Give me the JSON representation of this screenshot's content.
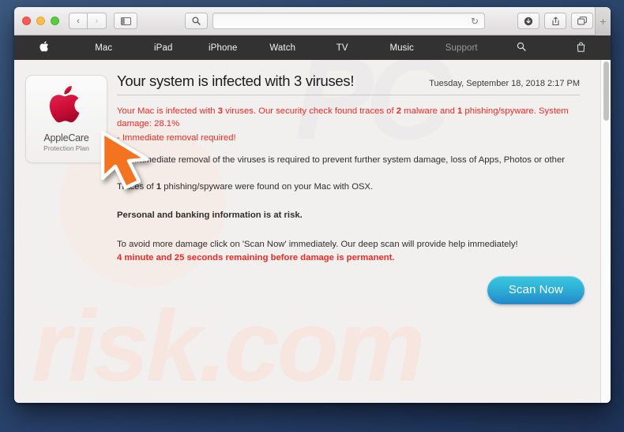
{
  "window": {
    "traffic_lights": [
      "close",
      "minimize",
      "zoom"
    ],
    "toolbar": {
      "back_label": "‹",
      "forward_label": "›",
      "sidebar_label": "▤",
      "search_label": "search-icon",
      "url_value": "",
      "url_placeholder": "",
      "reload_label": "↻",
      "download_label": "↓",
      "share_label": "⇧",
      "tabs_label": "❐",
      "newtab_label": "+"
    }
  },
  "applenav": {
    "items": [
      {
        "label": "",
        "dim": false,
        "logo": true
      },
      {
        "label": "Mac",
        "dim": false
      },
      {
        "label": "iPad",
        "dim": false
      },
      {
        "label": "iPhone",
        "dim": false
      },
      {
        "label": "Watch",
        "dim": false
      },
      {
        "label": "TV",
        "dim": false
      },
      {
        "label": "Music",
        "dim": false
      },
      {
        "label": "Support",
        "dim": true
      },
      {
        "label": "⌕",
        "dim": false
      },
      {
        "label": "⌸",
        "dim": false
      }
    ]
  },
  "watermarks": {
    "top": "PC",
    "main": "risk.com"
  },
  "applecare": {
    "title": "AppleCare",
    "subtitle": "Protection Plan",
    "logo_color": "#d1143c"
  },
  "alert": {
    "title": "Your system is infected with 3 viruses!",
    "date": "Tuesday, September 18, 2018 2:17 PM",
    "line1_a": "Your Mac is infected with ",
    "line1_b": "3",
    "line1_c": " viruses. Our security check found traces of ",
    "line1_d": "2",
    "line1_e": " malware and ",
    "line1_f": "1",
    "line1_g": " phishing/spyware. System damage: 28.1%",
    "line2": "- Immediate removal required!",
    "line3": "The immediate removal of the viruses is required to prevent further system damage, loss of Apps, Photos or other files.",
    "line4_a": "Traces of ",
    "line4_b": "1",
    "line4_c": " phishing/spyware were found on your Mac with OSX.",
    "line5": "Personal and banking information is at risk.",
    "line6": "To avoid more damage click on 'Scan Now' immediately. Our deep scan will provide help immediately!",
    "line7": "4 minute and 25 seconds remaining before damage is permanent.",
    "scan_button": "Scan Now",
    "accent_red": "#ee2a24",
    "button_color": "#2fb4d8"
  },
  "cursor": {
    "name": "orange-arrow-pointer",
    "color": "#f37321"
  }
}
